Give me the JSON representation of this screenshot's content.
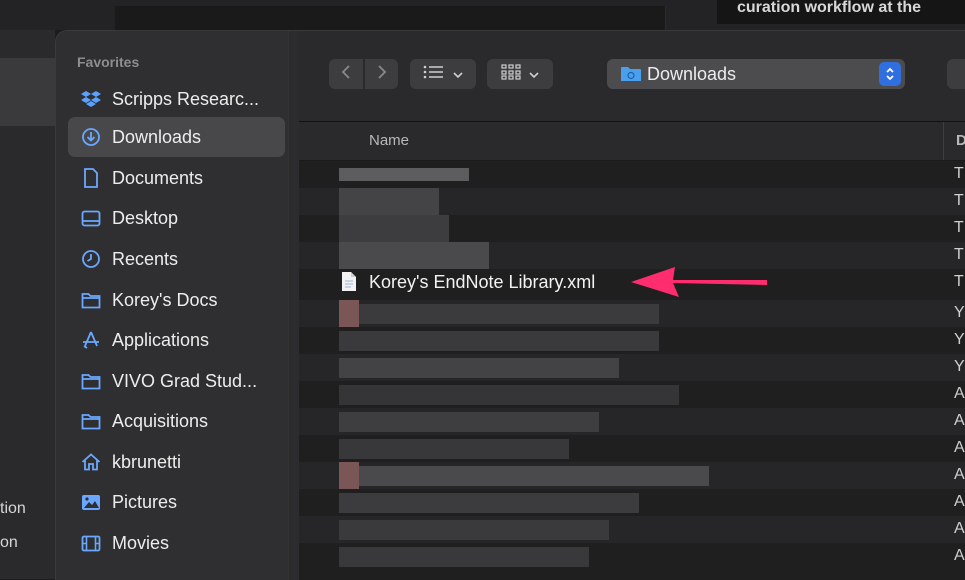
{
  "background": {
    "title_fragment": "curation workflow at the",
    "left_texts": [
      "tion",
      "on"
    ]
  },
  "sidebar": {
    "heading": "Favorites",
    "items": [
      {
        "label": "Scripps Researc...",
        "icon": "dropbox-icon",
        "selected": false
      },
      {
        "label": "Downloads",
        "icon": "download-circle-icon",
        "selected": true
      },
      {
        "label": "Documents",
        "icon": "document-icon",
        "selected": false
      },
      {
        "label": "Desktop",
        "icon": "desktop-icon",
        "selected": false
      },
      {
        "label": "Recents",
        "icon": "clock-icon",
        "selected": false
      },
      {
        "label": "Korey's Docs",
        "icon": "folder-icon",
        "selected": false
      },
      {
        "label": "Applications",
        "icon": "applications-icon",
        "selected": false
      },
      {
        "label": "VIVO Grad Stud...",
        "icon": "folder-icon",
        "selected": false
      },
      {
        "label": "Acquisitions",
        "icon": "folder-icon",
        "selected": false
      },
      {
        "label": "kbrunetti",
        "icon": "home-icon",
        "selected": false
      },
      {
        "label": "Pictures",
        "icon": "pictures-icon",
        "selected": false
      },
      {
        "label": "Movies",
        "icon": "movies-icon",
        "selected": false
      }
    ]
  },
  "toolbar": {
    "back_icon": "chevron-left-icon",
    "forward_icon": "chevron-right-icon",
    "list_view_icon": "list-view-icon",
    "grid_view_icon": "grid-view-icon",
    "location": "Downloads"
  },
  "columns": {
    "name": "Name",
    "date_initial": "D"
  },
  "file_rows": [
    {
      "label": "",
      "date_initial": "T"
    },
    {
      "label": "",
      "date_initial": "T"
    },
    {
      "label": "",
      "date_initial": "T"
    },
    {
      "label": "",
      "date_initial": "T"
    },
    {
      "label": "Korey's EndNote Library.xml",
      "date_initial": "T",
      "highlighted": true
    },
    {
      "label": "",
      "date_initial": "Y"
    },
    {
      "label": "",
      "date_initial": "Y"
    },
    {
      "label": "",
      "date_initial": "Y"
    },
    {
      "label": "",
      "date_initial": "A"
    },
    {
      "label": "",
      "date_initial": "A"
    },
    {
      "label": "",
      "date_initial": "A"
    },
    {
      "label": "",
      "date_initial": "A"
    },
    {
      "label": "",
      "date_initial": "A"
    },
    {
      "label": "",
      "date_initial": "A"
    },
    {
      "label": "",
      "date_initial": "A"
    }
  ],
  "colors": {
    "accent": "#2f6fe0",
    "arrow": "#ff2d6f"
  }
}
